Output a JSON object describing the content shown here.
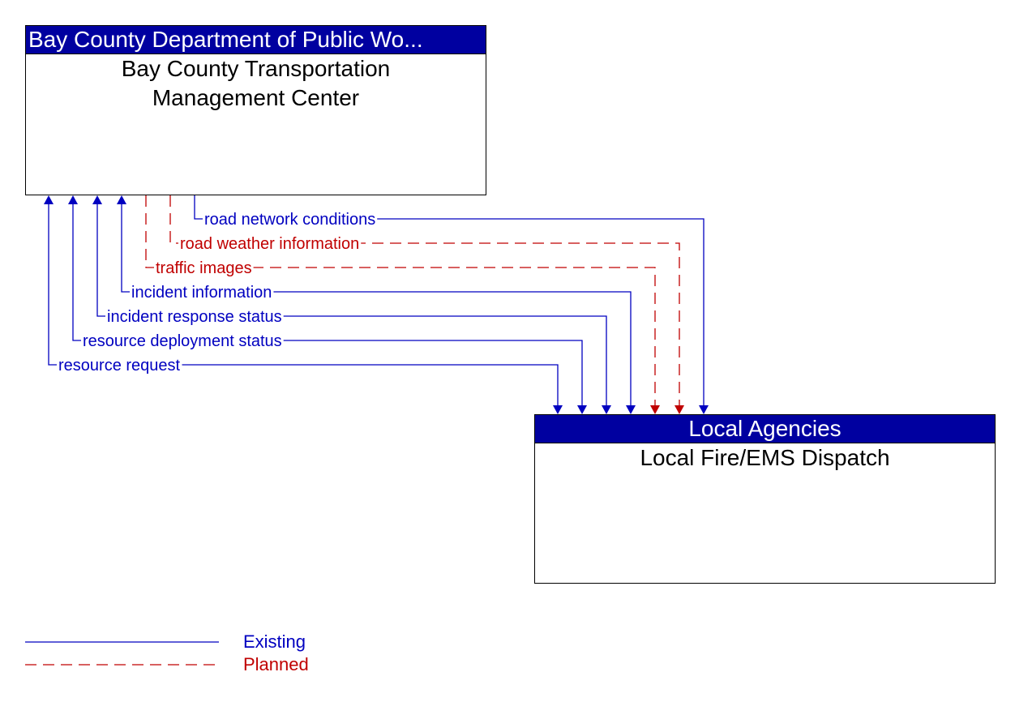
{
  "source": {
    "header": "Bay County Department of Public Wo...",
    "name_line1": "Bay County Transportation",
    "name_line2": "Management Center"
  },
  "destination": {
    "header": "Local Agencies",
    "name": "Local Fire/EMS Dispatch"
  },
  "colors": {
    "existing": "#0000c0",
    "planned": "#c00000",
    "header_bg": "#0000a0"
  },
  "flows": [
    {
      "label": "road network conditions",
      "status": "existing",
      "direction": "to-destination"
    },
    {
      "label": "road weather information",
      "status": "planned",
      "direction": "to-destination"
    },
    {
      "label": "traffic images",
      "status": "planned",
      "direction": "to-destination"
    },
    {
      "label": "incident information",
      "status": "existing",
      "direction": "to-destination"
    },
    {
      "label": "incident response status",
      "status": "existing",
      "direction": "to-destination"
    },
    {
      "label": "resource deployment status",
      "status": "existing",
      "direction": "to-destination"
    },
    {
      "label": "resource request",
      "status": "existing",
      "direction": "to-source"
    }
  ],
  "legend": {
    "existing": "Existing",
    "planned": "Planned"
  }
}
